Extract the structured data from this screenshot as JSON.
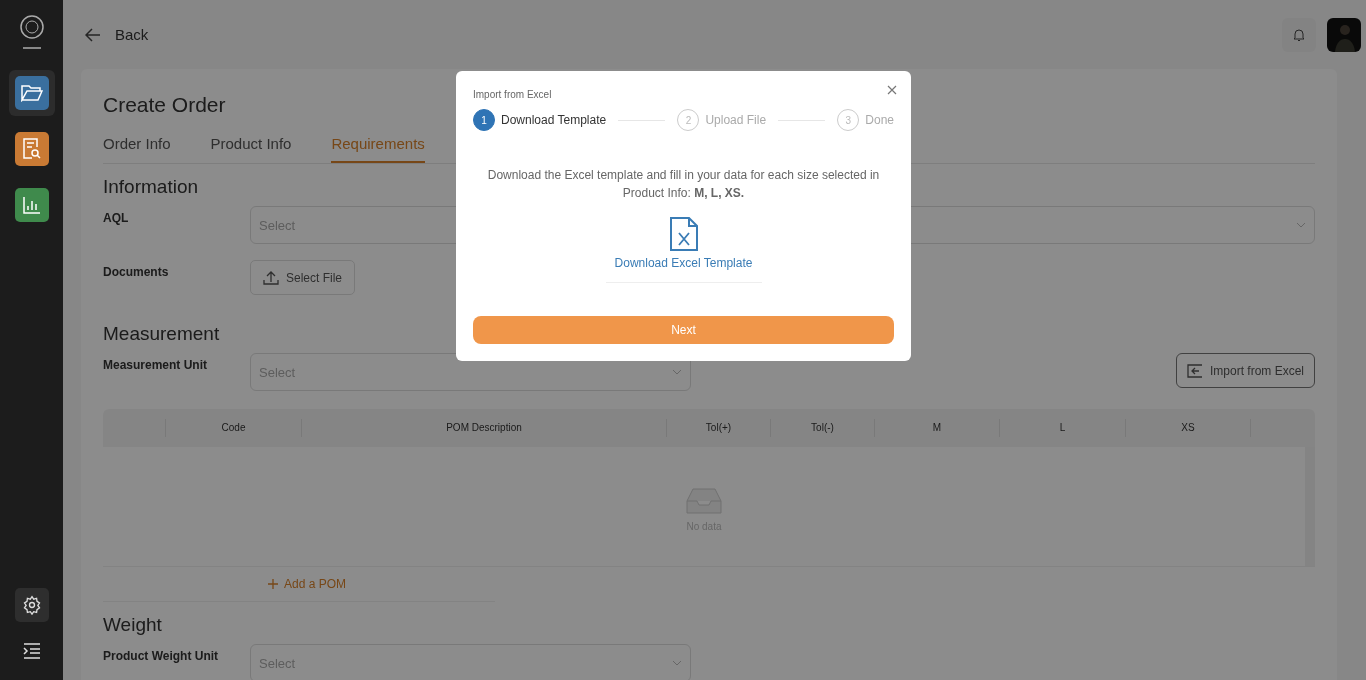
{
  "sidebar": {
    "items": [
      {
        "kind": "folder",
        "color": "#3a6f9e",
        "selected": true
      },
      {
        "kind": "report",
        "color": "#c97a34",
        "selected": false
      },
      {
        "kind": "chart",
        "color": "#3f8a4c",
        "selected": false
      }
    ],
    "footer": [
      {
        "kind": "settings"
      },
      {
        "kind": "menu"
      }
    ]
  },
  "header": {
    "back": "Back"
  },
  "page": {
    "title": "Create Order",
    "tabs": [
      {
        "label": "Order Info",
        "selected": false
      },
      {
        "label": "Product Info",
        "selected": false
      },
      {
        "label": "Requirements",
        "selected": true
      }
    ],
    "information": {
      "title": "Information",
      "aql_label": "AQL",
      "aql_placeholder": "Select",
      "documents_label": "Documents",
      "select_file": "Select File"
    },
    "measurement": {
      "title": "Measurement",
      "unit_label": "Measurement Unit",
      "unit_placeholder": "Select",
      "import_button": "Import from Excel",
      "table": {
        "columns": [
          "",
          "Code",
          "POM Description",
          "Tol(+)",
          "Tol(-)",
          "M",
          "L",
          "XS",
          ""
        ],
        "empty": "No data"
      },
      "add_button": "Add a POM"
    },
    "weight": {
      "title": "Weight",
      "unit_label": "Product Weight Unit",
      "unit_placeholder": "Select"
    }
  },
  "modal": {
    "title": "Import from Excel",
    "steps": [
      {
        "number": "1",
        "label": "Download Template",
        "active": true
      },
      {
        "number": "2",
        "label": "Upload File",
        "active": false
      },
      {
        "number": "3",
        "label": "Done",
        "active": false
      }
    ],
    "description": "Download the Excel template and fill in your data for each size selected in Product Info: **M, L, XS.**",
    "download_link": "Download Excel Template",
    "next_button": "Next"
  }
}
